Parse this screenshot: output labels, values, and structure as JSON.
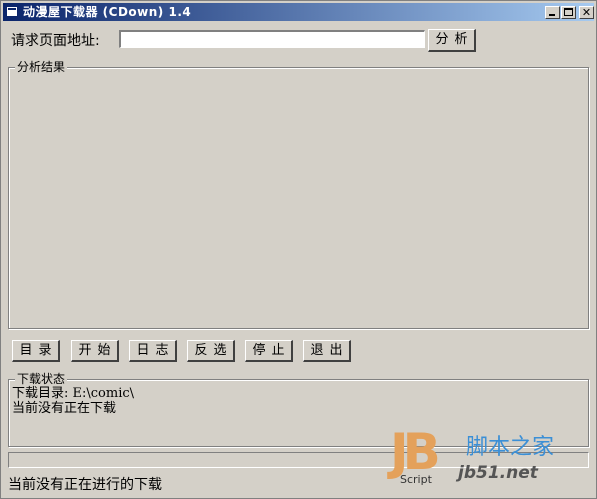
{
  "window": {
    "title": "动漫屋下载器 (CDown) 1.4"
  },
  "url_bar": {
    "label": "请求页面地址:",
    "value": "",
    "analyze_label": "分析"
  },
  "result_group": {
    "title": "分析结果"
  },
  "toolbar": {
    "directory_label": "目录",
    "start_label": "开始",
    "log_label": "日志",
    "invert_label": "反选",
    "stop_label": "停止",
    "exit_label": "退出"
  },
  "download_status": {
    "title": "下载状态",
    "directory_line": "下载目录: E:\\comic\\",
    "current_line": "当前没有正在下载"
  },
  "progress": {
    "value": 0
  },
  "statusbar": {
    "text": "当前没有正在进行的下载"
  },
  "watermark": {
    "logo": "JB",
    "script": "Script",
    "site_name": "脚本之家",
    "url": "jb51.net"
  }
}
